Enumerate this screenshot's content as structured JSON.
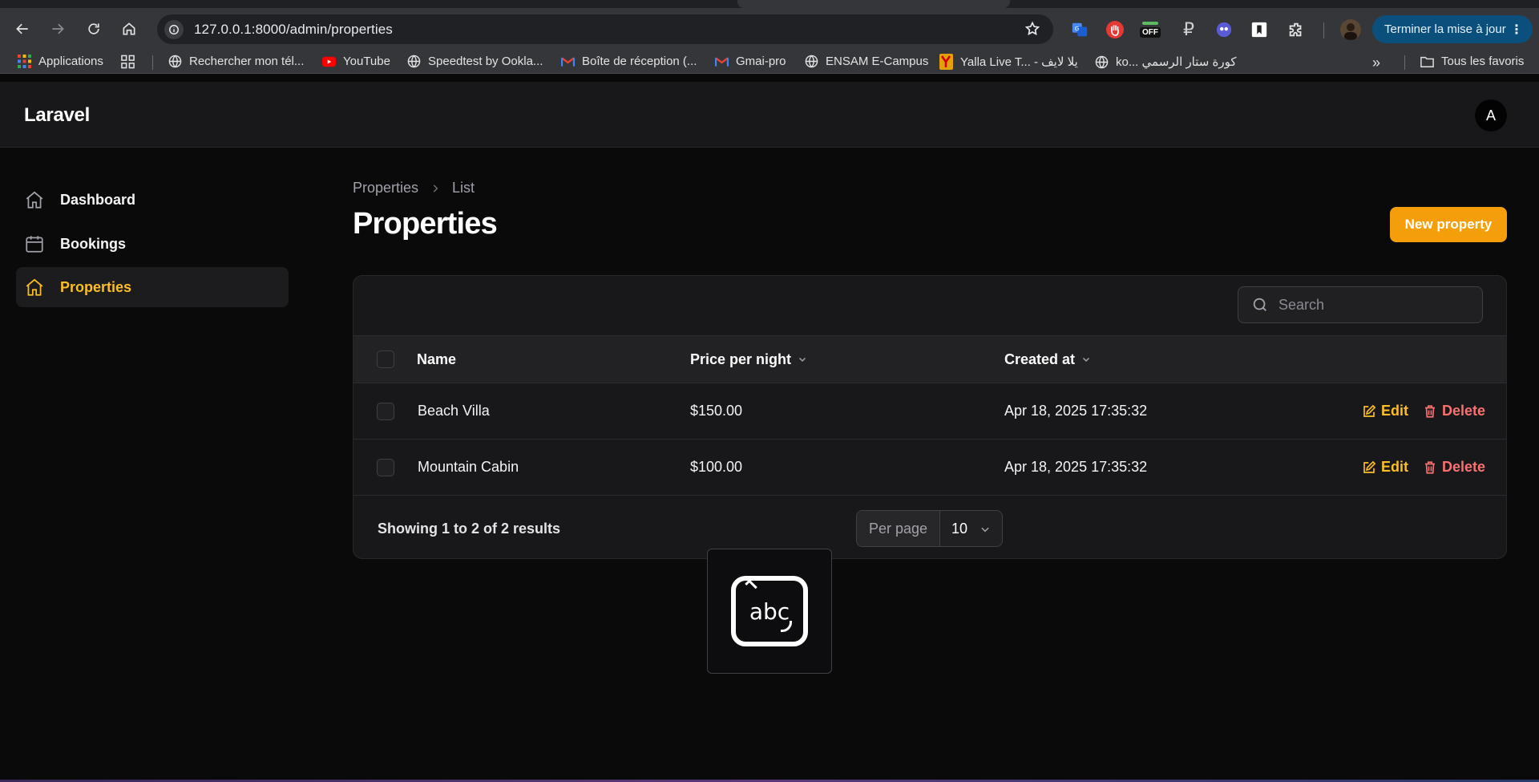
{
  "browser": {
    "url": "127.0.0.1:8000/admin/properties",
    "update_button": "Terminer la mise à jour",
    "extension_badge": "OFF",
    "bookmarks": [
      {
        "label": "Applications",
        "icon": "apps-grid-icon"
      },
      {
        "label": "Rechercher mon tél...",
        "icon": "globe-icon"
      },
      {
        "label": "YouTube",
        "icon": "youtube-icon"
      },
      {
        "label": "Speedtest by Ookla...",
        "icon": "globe-icon"
      },
      {
        "label": "Boîte de réception (...",
        "icon": "gmail-icon"
      },
      {
        "label": "Gmai-pro",
        "icon": "gmail-icon"
      },
      {
        "label": "ENSAM E-Campus",
        "icon": "globe-icon"
      },
      {
        "label": "Yalla Live T... - يلا لايف",
        "icon": "yalla-icon"
      },
      {
        "label": "ko... كورة ستار الرسمي",
        "icon": "globe-icon"
      }
    ],
    "all_bookmarks": "Tous les favoris"
  },
  "app": {
    "brand": "Laravel",
    "avatar_initial": "A"
  },
  "sidebar": {
    "items": [
      {
        "label": "Dashboard",
        "icon": "home-icon",
        "active": false
      },
      {
        "label": "Bookings",
        "icon": "calendar-icon",
        "active": false
      },
      {
        "label": "Properties",
        "icon": "home-icon",
        "active": true
      }
    ]
  },
  "page": {
    "breadcrumb": [
      "Properties",
      "List"
    ],
    "title": "Properties",
    "new_button": "New property"
  },
  "table": {
    "search_placeholder": "Search",
    "columns": [
      {
        "label": "Name",
        "sortable": false
      },
      {
        "label": "Price per night",
        "sortable": true
      },
      {
        "label": "Created at",
        "sortable": true
      }
    ],
    "rows": [
      {
        "name": "Beach Villa",
        "price": "$150.00",
        "created_at": "Apr 18, 2025 17:35:32"
      },
      {
        "name": "Mountain Cabin",
        "price": "$100.00",
        "created_at": "Apr 18, 2025 17:35:32"
      }
    ],
    "actions": {
      "edit": "Edit",
      "delete": "Delete"
    },
    "footer": {
      "summary": "Showing 1 to 2 of 2 results",
      "per_page_label": "Per page",
      "per_page_value": "10"
    }
  },
  "ime_indicator": {
    "text": "abc"
  },
  "colors": {
    "accent": "#f59e0b",
    "danger": "#f87171",
    "background": "#0a0a0b"
  }
}
